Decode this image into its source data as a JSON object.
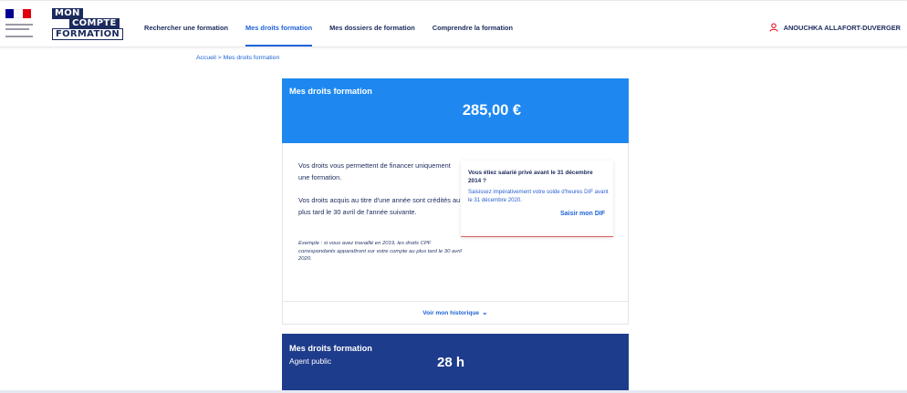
{
  "header": {
    "logo": {
      "line1": "MON",
      "line2": "COMPTE",
      "line3": "FORMATION"
    },
    "nav": [
      {
        "label": "Rechercher une formation",
        "active": false
      },
      {
        "label": "Mes droits formation",
        "active": true
      },
      {
        "label": "Mes dossiers de formation",
        "active": false
      },
      {
        "label": "Comprendre la formation",
        "active": false
      }
    ],
    "user_name": "ANOUCHKA ALLAFORT-DUVERGER",
    "user_icon": "user-icon"
  },
  "breadcrumb": "Accueil > Mes droits formation",
  "card_private": {
    "title": "Mes droits formation",
    "amount": "285,00 €",
    "paragraph1": "Vos droits vous permettent de financer uniquement une formation.",
    "paragraph2": "Vos droits acquis au titre d'une année sont crédités au plus tard le 30 avril de l'année suivante.",
    "example": "Exemple : si vous avez travaillé en 2019, les droits CPF correspondants apparaîtront sur votre compte au plus tard le 30 avril 2020.",
    "dif_question": "Vous étiez salarié privé avant le 31 décembre 2014 ?",
    "dif_description": "Saisissez impérativement votre solde d'heures DIF avant le 31 décembre 2020.",
    "dif_button": "Saisir mon DIF",
    "history_link": "Voir mon historique",
    "history_icon": "chevron-down-icon"
  },
  "card_public": {
    "title": "Mes droits formation",
    "subtitle": "Agent public",
    "hours": "28 h"
  },
  "colors": {
    "primary_blue": "#1e88f0",
    "dark_blue": "#1e3c8c",
    "navy": "#1b2a5c",
    "link_blue": "#1e63d6",
    "accent_red": "#e06060"
  }
}
